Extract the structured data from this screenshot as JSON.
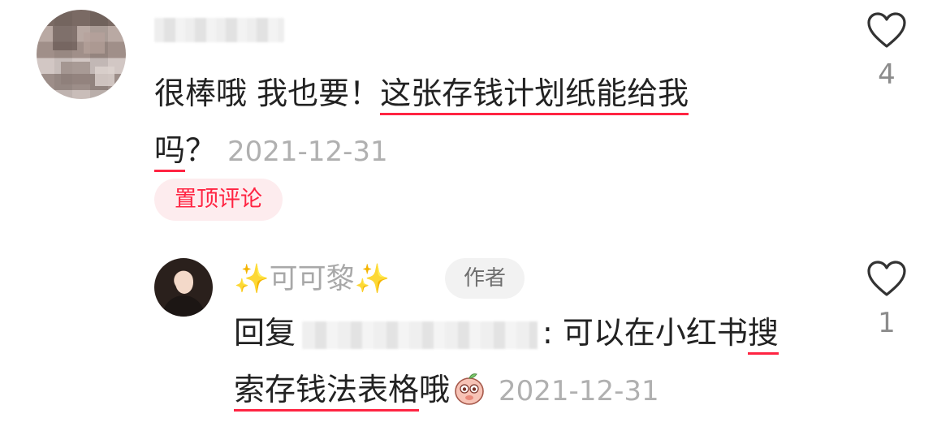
{
  "comment": {
    "text_plain": "很棒哦 我也要！",
    "text_highlight": "这张存钱计划纸能给我",
    "text_highlight_2": "吗",
    "text_end": "？",
    "date": "2021-12-31",
    "badge": "置顶评论",
    "likes": "4",
    "icon": "heart-outline-icon"
  },
  "reply": {
    "author_prefix": "✨",
    "author_name": "可可黎",
    "author_suffix": "✨",
    "author_badge": "作者",
    "reply_label": "回复",
    "text_after_name": ": 可以在小红书",
    "text_highlight_1": "搜",
    "text_highlight_2": "索存钱法表格",
    "text_end": "哦",
    "emoji": "peach-face-emoji",
    "date": "2021-12-31",
    "likes": "1",
    "icon": "heart-outline-icon"
  },
  "colors": {
    "accent_red": "#ff2442",
    "badge_pink_bg": "#fdecee",
    "gray_text": "#b0b0b0"
  }
}
